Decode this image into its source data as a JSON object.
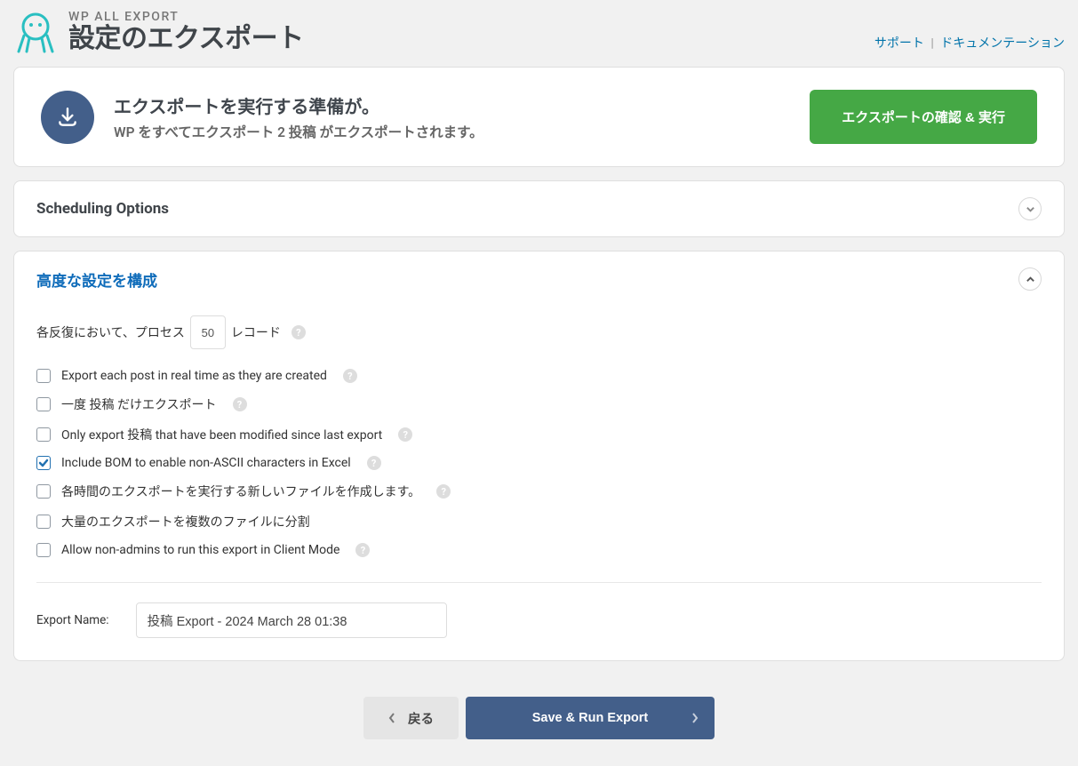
{
  "header": {
    "brand": "WP ALL EXPORT",
    "title": "設定のエクスポート",
    "support_link": "サポート",
    "docs_link": "ドキュメンテーション"
  },
  "top": {
    "ready_title": "エクスポートを実行する準備が。",
    "ready_sub": "WP をすべてエクスポート 2 投稿 がエクスポートされます。",
    "run_button": "エクスポートの確認 & 実行"
  },
  "scheduling": {
    "title": "Scheduling Options"
  },
  "advanced": {
    "title": "高度な設定を構成",
    "records_prefix": "各反復において、プロセス",
    "records_value": "50",
    "records_suffix": "レコード",
    "checkboxes": [
      {
        "label": "Export each post in real time as they are created",
        "checked": false,
        "help": true
      },
      {
        "label": "一度 投稿 だけエクスポート",
        "checked": false,
        "help": true
      },
      {
        "label": "Only export 投稿 that have been modified since last export",
        "checked": false,
        "help": true
      },
      {
        "label": "Include BOM to enable non-ASCII characters in Excel",
        "checked": true,
        "help": true
      },
      {
        "label": "各時間のエクスポートを実行する新しいファイルを作成します。",
        "checked": false,
        "help": true
      },
      {
        "label": "大量のエクスポートを複数のファイルに分割",
        "checked": false,
        "help": false
      },
      {
        "label": "Allow non-admins to run this export in Client Mode",
        "checked": false,
        "help": true
      }
    ],
    "export_name_label": "Export Name:",
    "export_name_value": "投稿 Export - 2024 March 28 01:38"
  },
  "footer": {
    "back": "戻る",
    "save": "Save & Run Export"
  }
}
